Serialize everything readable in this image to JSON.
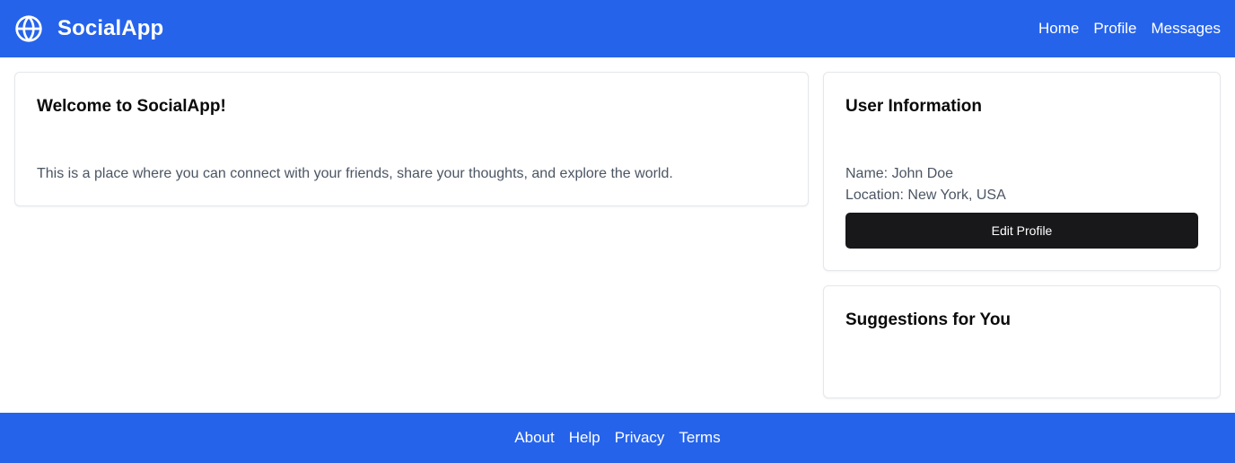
{
  "header": {
    "logo_icon": "globe-icon",
    "brand": "SocialApp",
    "nav": [
      {
        "label": "Home"
      },
      {
        "label": "Profile"
      },
      {
        "label": "Messages"
      }
    ]
  },
  "welcome": {
    "title": "Welcome to SocialApp!",
    "body": "This is a place where you can connect with your friends, share your thoughts, and explore the world."
  },
  "user_info": {
    "title": "User Information",
    "name": "Name: John Doe",
    "location": "Location: New York, USA",
    "edit_button": "Edit Profile"
  },
  "suggestions": {
    "title": "Suggestions for You"
  },
  "footer": {
    "links": [
      {
        "label": "About"
      },
      {
        "label": "Help"
      },
      {
        "label": "Privacy"
      },
      {
        "label": "Terms"
      }
    ]
  },
  "colors": {
    "primary": "#2563eb",
    "button": "#18181b",
    "muted_text": "#4b5563",
    "border": "#e5e7eb"
  }
}
